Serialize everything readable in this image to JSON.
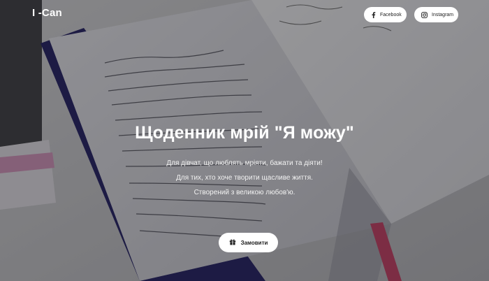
{
  "header": {
    "logo_text": "I -Can",
    "social": {
      "facebook_label": "Facebook",
      "instagram_label": "Instagram"
    }
  },
  "hero": {
    "title": "Щоденник мрій \"Я можу\"",
    "lines": [
      "Для дівчат, що люблять мріяти, бажати та діяти!",
      "Для тих, хто хоче творити щасливе життя.",
      "Створений з великою любов'ю."
    ],
    "order_button_label": "Замовити"
  },
  "icons": {
    "facebook": "facebook-icon",
    "instagram": "instagram-icon",
    "order": "gift-box-icon"
  },
  "colors": {
    "button_bg": "#ffffff",
    "text_primary": "#ffffff",
    "overlay": "rgba(0,0,0,0.38)"
  }
}
